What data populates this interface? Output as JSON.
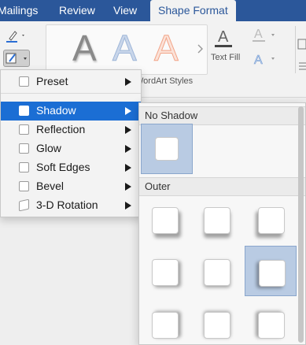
{
  "ribbon": {
    "tabs": [
      {
        "label": "Mailings",
        "active": false
      },
      {
        "label": "Review",
        "active": false
      },
      {
        "label": "View",
        "active": false
      },
      {
        "label": "Shape Format",
        "active": true
      }
    ],
    "wordart_gallery": {
      "letters": [
        "A",
        "A",
        "A"
      ],
      "colors": [
        "#8a8a8a",
        "#9eb6d8",
        "#f2a488"
      ]
    },
    "wordart_styles_label": "WordArt Styles",
    "text_fill_label": "Text Fill",
    "brand_color": "#2b579a"
  },
  "menu": {
    "items": [
      {
        "label": "Preset",
        "selected": false
      },
      {
        "label": "Shadow",
        "selected": true
      },
      {
        "label": "Reflection",
        "selected": false
      },
      {
        "label": "Glow",
        "selected": false
      },
      {
        "label": "Soft Edges",
        "selected": false
      },
      {
        "label": "Bevel",
        "selected": false
      },
      {
        "label": "3-D Rotation",
        "selected": false
      }
    ],
    "highlight_color": "#1b6ed4"
  },
  "submenu": {
    "no_shadow_label": "No Shadow",
    "outer_label": "Outer",
    "selected_outer_index": 5
  }
}
